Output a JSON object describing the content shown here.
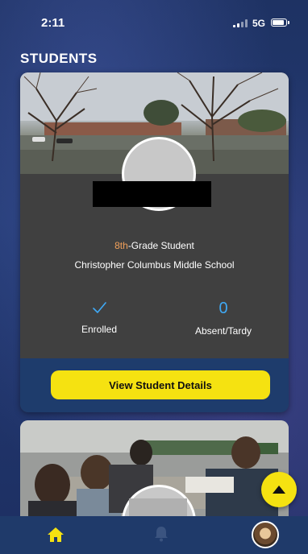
{
  "status_bar": {
    "time": "2:11",
    "network": "5G"
  },
  "page": {
    "title": "STUDENTS"
  },
  "student_card": {
    "grade_number": "8th",
    "grade_suffix": "-Grade Student",
    "school": "Christopher Columbus Middle School",
    "enrolled_label": "Enrolled",
    "absent_count": "0",
    "absent_label": "Absent/Tardy",
    "details_button": "View Student Details"
  },
  "nav": {
    "items": [
      "home-icon",
      "bell-icon",
      "profile-avatar"
    ]
  },
  "colors": {
    "accent_yellow": "#f5e211",
    "grade_orange": "#f0a05a",
    "stat_blue": "#3fa9f5",
    "nav_background": "#1f3a6a"
  }
}
